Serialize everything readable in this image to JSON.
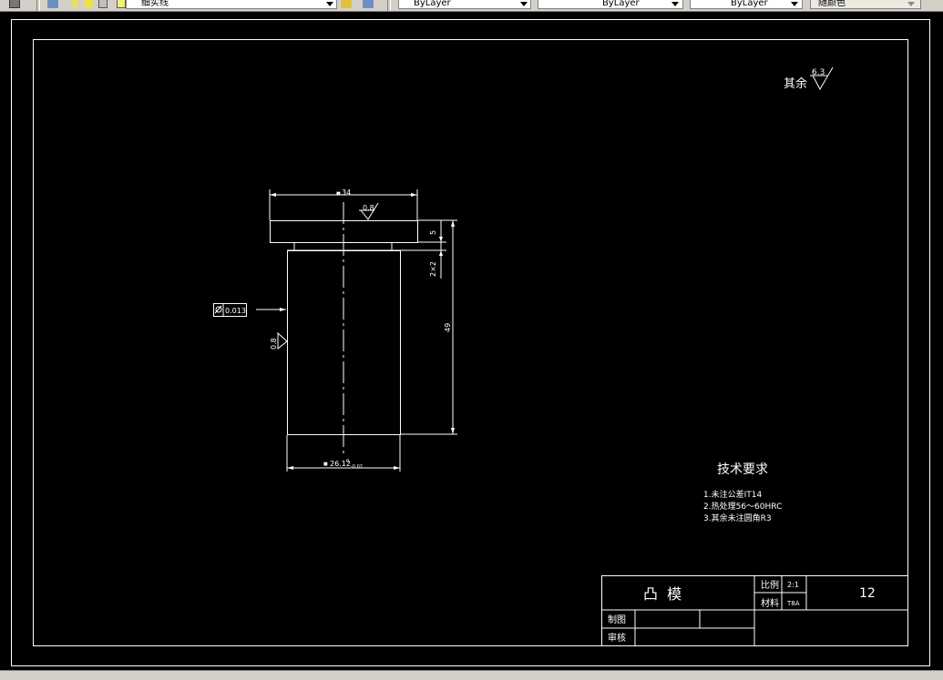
{
  "toolbar": {
    "layer_name": "细实线",
    "color_control": "ByLayer",
    "linetype_control": "ByLayer",
    "lineweight_control": "ByLayer",
    "plotstyle_control": "随颜色"
  },
  "drawing": {
    "roughness_note": {
      "prefix": "其余",
      "value": "6.3"
    },
    "dimensions": {
      "top_width": "34",
      "top_surface_roughness": "0.8",
      "flange_thickness": "5",
      "undercut": "2×2",
      "total_height": "49",
      "side_roughness": "0.8",
      "bottom_width": "26.12",
      "bottom_width_upper_tol": "0",
      "bottom_width_lower_tol": "-0.02",
      "diameter_prefix": "■",
      "cylindricity_tolerance": "0.013"
    },
    "technical_requirements": {
      "title": "技术要求",
      "items": [
        "1.未注公差IT14",
        "2.热处理56～60HRC",
        "3.其余未注圆角R3"
      ]
    },
    "title_block": {
      "part_name": "凸  模",
      "scale_label": "比例",
      "scale_value": "2:1",
      "material_label": "材料",
      "material_value": "T8A",
      "drawing_number": "12",
      "drawn_by_label": "制图",
      "checked_by_label": "审核"
    }
  },
  "colors": {
    "background": "#000000",
    "lines": "#ffffff",
    "toolbar": "#d4d0c8"
  }
}
